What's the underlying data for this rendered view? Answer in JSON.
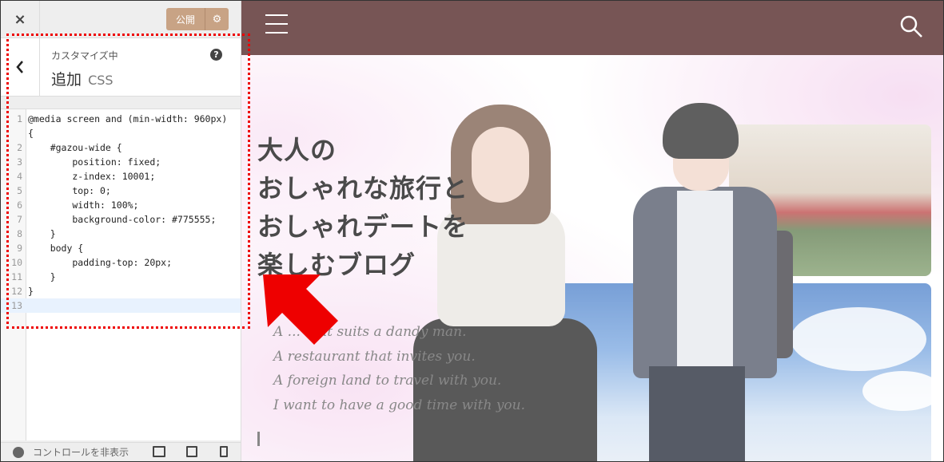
{
  "customizer": {
    "close_icon": "×",
    "publish_label": "公開",
    "settings_icon": "⚙",
    "back_icon": "‹",
    "breadcrumb": "カスタマイズ中",
    "title_main": "追加",
    "title_css": "CSS",
    "help_icon": "?",
    "footer_hide_label": "コントロールを非表示"
  },
  "editor": {
    "lines": [
      {
        "num": "1",
        "text": "@media screen and (min-width: 960px)"
      },
      {
        "num": "",
        "text": "{"
      },
      {
        "num": "2",
        "text": "    #gazou-wide {"
      },
      {
        "num": "3",
        "text": "        position: fixed;"
      },
      {
        "num": "4",
        "text": "        z-index: 10001;"
      },
      {
        "num": "5",
        "text": "        top: 0;"
      },
      {
        "num": "6",
        "text": "        width: 100%;"
      },
      {
        "num": "7",
        "text": "        background-color: #775555;"
      },
      {
        "num": "8",
        "text": "    }"
      },
      {
        "num": "9",
        "text": "    body {"
      },
      {
        "num": "10",
        "text": "        padding-top: 20px;"
      },
      {
        "num": "11",
        "text": "    }"
      },
      {
        "num": "12",
        "text": "}"
      },
      {
        "num": "13",
        "text": ""
      }
    ]
  },
  "site": {
    "header_color": "#775555",
    "headline": [
      "大人の",
      "おしゃれな旅行と",
      "おしゃれデートを",
      "楽しむブログ"
    ],
    "subcopy": [
      "A ... that suits a dandy man.",
      "A restaurant that invites you.",
      "A foreign land to travel with you.",
      "I want to have a good time with you."
    ]
  },
  "annotation": {
    "highlight_color": "#ee0000"
  }
}
